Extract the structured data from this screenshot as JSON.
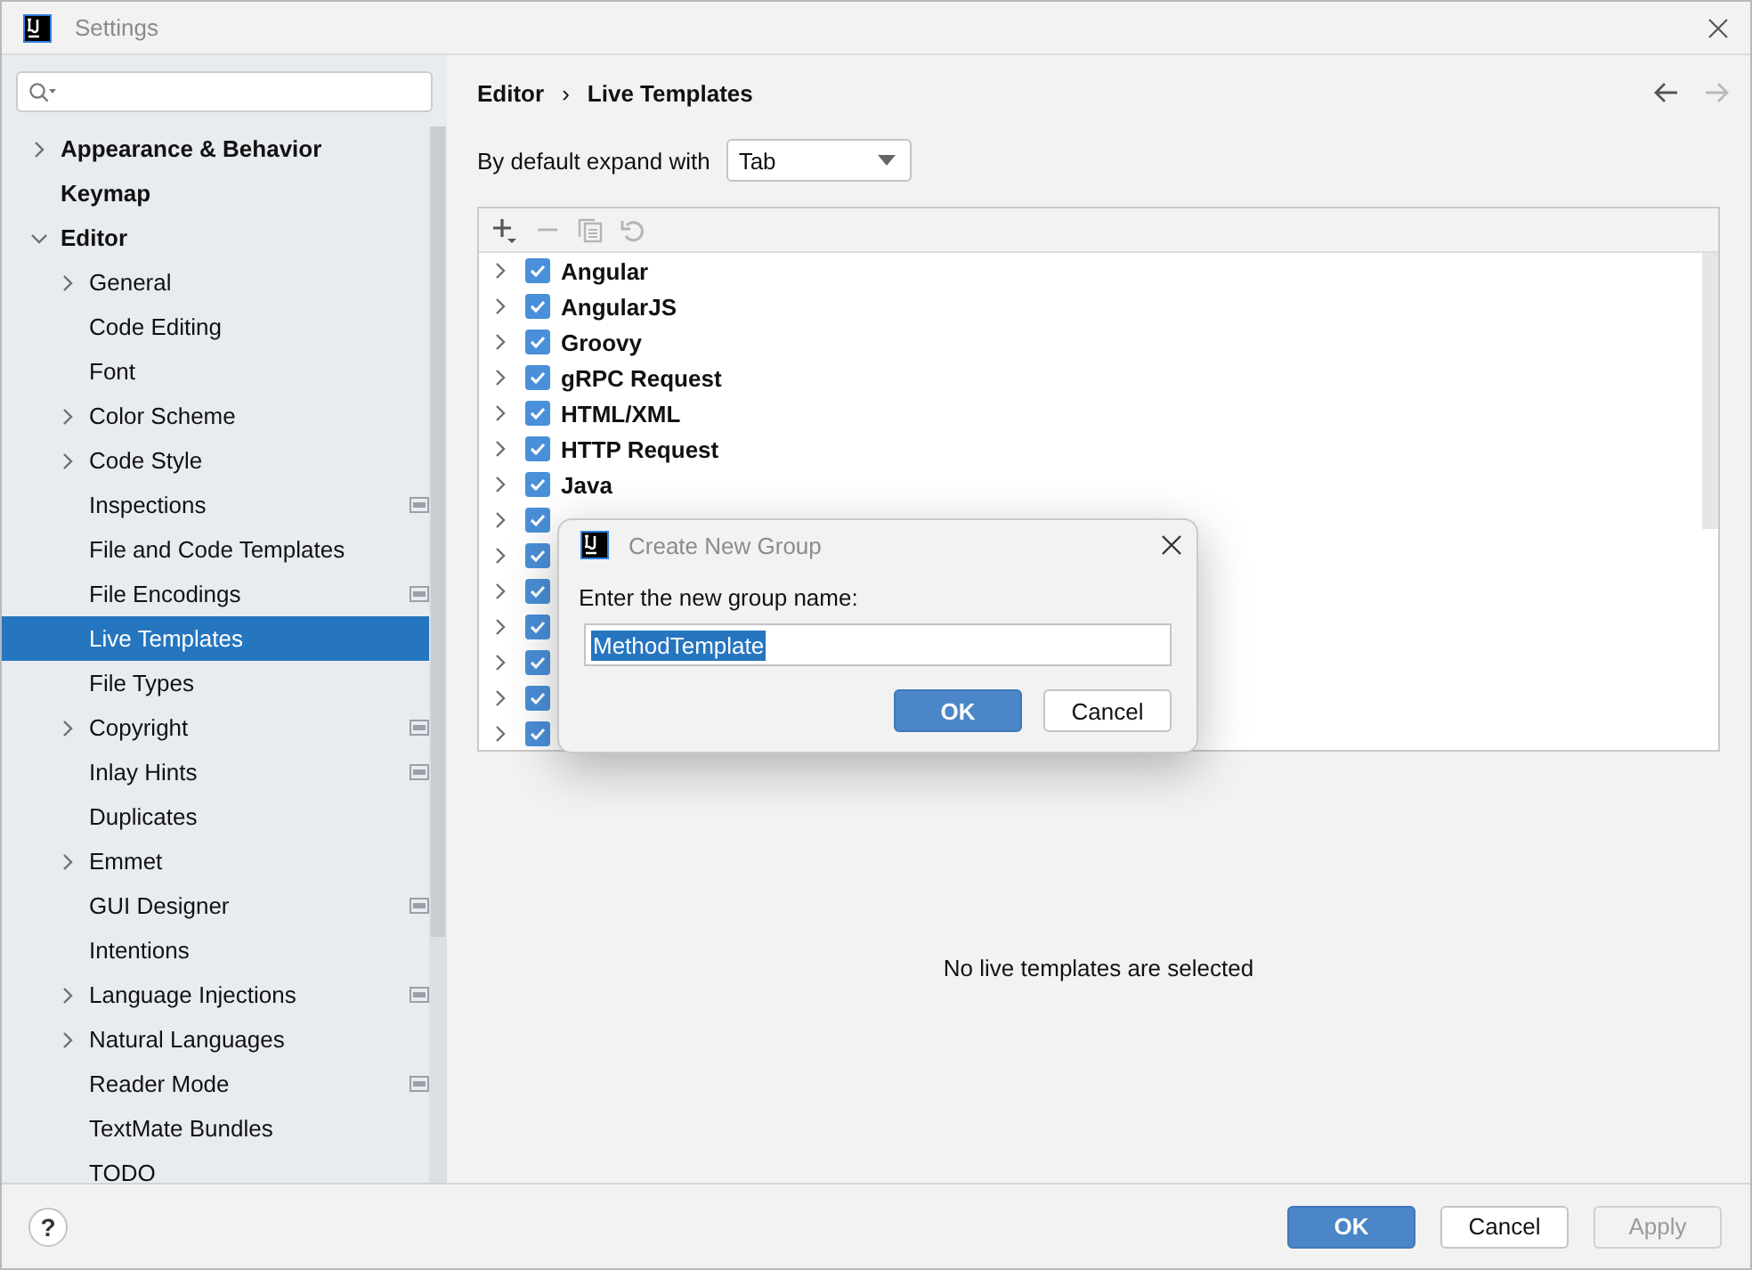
{
  "window": {
    "title": "Settings"
  },
  "sidebar": {
    "items": [
      {
        "label": "Appearance & Behavior",
        "kind": "folder",
        "expanded": false,
        "selected": false,
        "badge": false
      },
      {
        "label": "Keymap",
        "kind": "page",
        "selected": false,
        "badge": false
      },
      {
        "label": "Editor",
        "kind": "folder",
        "expanded": true,
        "selected": false,
        "badge": false,
        "children": [
          {
            "label": "General",
            "kind": "folder",
            "expanded": false,
            "selected": false,
            "badge": false
          },
          {
            "label": "Code Editing",
            "kind": "page",
            "selected": false,
            "badge": false
          },
          {
            "label": "Font",
            "kind": "page",
            "selected": false,
            "badge": false
          },
          {
            "label": "Color Scheme",
            "kind": "folder",
            "expanded": false,
            "selected": false,
            "badge": false
          },
          {
            "label": "Code Style",
            "kind": "folder",
            "expanded": false,
            "selected": false,
            "badge": false
          },
          {
            "label": "Inspections",
            "kind": "page",
            "selected": false,
            "badge": true
          },
          {
            "label": "File and Code Templates",
            "kind": "page",
            "selected": false,
            "badge": false
          },
          {
            "label": "File Encodings",
            "kind": "page",
            "selected": false,
            "badge": true
          },
          {
            "label": "Live Templates",
            "kind": "page",
            "selected": true,
            "badge": false
          },
          {
            "label": "File Types",
            "kind": "page",
            "selected": false,
            "badge": false
          },
          {
            "label": "Copyright",
            "kind": "folder",
            "expanded": false,
            "selected": false,
            "badge": true
          },
          {
            "label": "Inlay Hints",
            "kind": "page",
            "selected": false,
            "badge": true
          },
          {
            "label": "Duplicates",
            "kind": "page",
            "selected": false,
            "badge": false
          },
          {
            "label": "Emmet",
            "kind": "folder",
            "expanded": false,
            "selected": false,
            "badge": false
          },
          {
            "label": "GUI Designer",
            "kind": "page",
            "selected": false,
            "badge": true
          },
          {
            "label": "Intentions",
            "kind": "page",
            "selected": false,
            "badge": false
          },
          {
            "label": "Language Injections",
            "kind": "folder",
            "expanded": false,
            "selected": false,
            "badge": true
          },
          {
            "label": "Natural Languages",
            "kind": "folder",
            "expanded": false,
            "selected": false,
            "badge": false
          },
          {
            "label": "Reader Mode",
            "kind": "page",
            "selected": false,
            "badge": true
          },
          {
            "label": "TextMate Bundles",
            "kind": "page",
            "selected": false,
            "badge": false
          },
          {
            "label": "TODO",
            "kind": "page",
            "selected": false,
            "badge": false
          }
        ]
      }
    ]
  },
  "breadcrumb": {
    "items": [
      "Editor",
      "Live Templates"
    ],
    "separator": "›"
  },
  "navigation": {
    "back_enabled": true,
    "forward_enabled": false
  },
  "expand_with": {
    "label": "By default expand with",
    "value": "Tab"
  },
  "toolbar": [
    {
      "kind": "add",
      "disabled": false
    },
    {
      "kind": "remove",
      "disabled": true
    },
    {
      "kind": "copy",
      "disabled": true
    },
    {
      "kind": "restore",
      "disabled": true
    }
  ],
  "templates": [
    {
      "label": "Angular",
      "checked": true
    },
    {
      "label": "AngularJS",
      "checked": true
    },
    {
      "label": "Groovy",
      "checked": true
    },
    {
      "label": "gRPC Request",
      "checked": true
    },
    {
      "label": "HTML/XML",
      "checked": true
    },
    {
      "label": "HTTP Request",
      "checked": true
    },
    {
      "label": "Java",
      "checked": true
    },
    {
      "checked": true
    },
    {
      "checked": true
    },
    {
      "checked": true
    },
    {
      "checked": true
    },
    {
      "checked": true
    },
    {
      "checked": true
    },
    {
      "checked": true
    }
  ],
  "empty_message": "No live templates are selected",
  "dialog": {
    "title": "Create New Group",
    "prompt": "Enter the new group name:",
    "value": "MethodTemplate",
    "value_selected": true,
    "buttons": [
      {
        "label": "OK",
        "kind": "primary"
      },
      {
        "label": "Cancel",
        "kind": "secondary"
      }
    ]
  },
  "help_button": {
    "label": "?"
  },
  "buttons": [
    {
      "label": "OK",
      "kind": "primary",
      "disabled": false
    },
    {
      "label": "Cancel",
      "kind": "secondary",
      "disabled": false
    },
    {
      "label": "Apply",
      "kind": "secondary",
      "disabled": true
    }
  ]
}
